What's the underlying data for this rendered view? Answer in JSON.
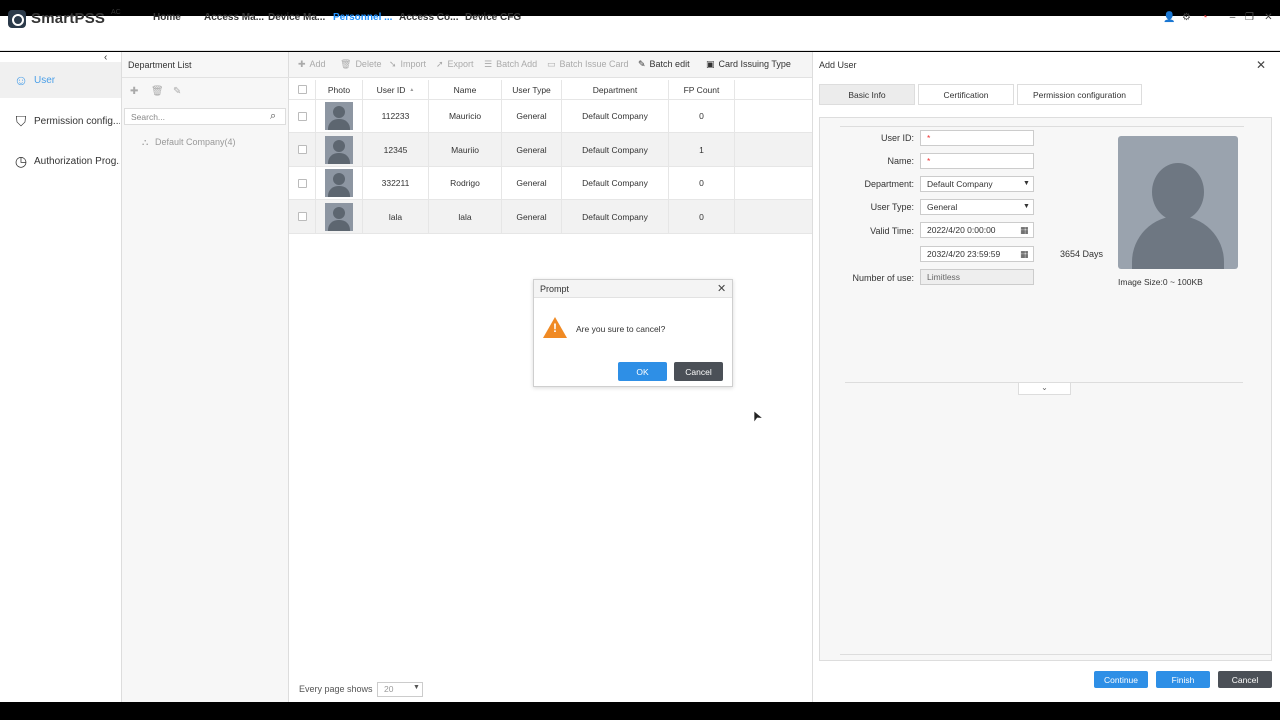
{
  "app": {
    "name": "SmartPSS",
    "name_sup": "AC"
  },
  "nav": [
    {
      "label": "Home"
    },
    {
      "label": "Access Ma..."
    },
    {
      "label": "Device Ma..."
    },
    {
      "label": "Personnel ..."
    },
    {
      "label": "Access Co..."
    },
    {
      "label": "Device CFG"
    }
  ],
  "sidebar": {
    "collapse": "‹",
    "items": [
      {
        "label": "User"
      },
      {
        "label": "Permission config..."
      },
      {
        "label": "Authorization Prog..."
      }
    ]
  },
  "department": {
    "title": "Department List",
    "search_placeholder": "Search...",
    "tree_root": "Default Company(4)"
  },
  "toolbar": {
    "add": "Add",
    "delete": "Delete",
    "import": "Import",
    "export": "Export",
    "batch_add": "Batch Add",
    "batch_issue_card": "Batch Issue Card",
    "batch_edit": "Batch edit",
    "card_issuing_type": "Card Issuing Type"
  },
  "table": {
    "columns": [
      "Photo",
      "User ID",
      "Name",
      "User Type",
      "Department",
      "FP Count"
    ],
    "sort_indicator": "▲",
    "rows": [
      {
        "user_id": "112233",
        "name": "Mauricio",
        "user_type": "General",
        "department": "Default Company",
        "fp_count": "0"
      },
      {
        "user_id": "12345",
        "name": "Mauriio",
        "user_type": "General",
        "department": "Default Company",
        "fp_count": "1"
      },
      {
        "user_id": "332211",
        "name": "Rodrigo",
        "user_type": "General",
        "department": "Default Company",
        "fp_count": "0"
      },
      {
        "user_id": "lala",
        "name": "lala",
        "user_type": "General",
        "department": "Default Company",
        "fp_count": "0"
      }
    ]
  },
  "pager": {
    "label": "Every page shows",
    "value": "20"
  },
  "add_user": {
    "title": "Add User",
    "tabs": [
      {
        "label": "Basic Info"
      },
      {
        "label": "Certification"
      },
      {
        "label": "Permission configuration"
      }
    ],
    "labels": {
      "user_id": "User ID:",
      "name": "Name:",
      "department": "Department:",
      "user_type": "User Type:",
      "valid_time": "Valid Time:",
      "number_of_use": "Number of use:"
    },
    "required_mark": "*",
    "department_value": "Default Company",
    "user_type_value": "General",
    "valid_start": "2022/4/20 0:00:00",
    "valid_end": "2032/4/20 23:59:59",
    "days": "3654 Days",
    "number_of_use_value": "Limitless",
    "image_size": "Image Size:0 ~ 100KB",
    "buttons": {
      "continue": "Continue",
      "finish": "Finish",
      "cancel": "Cancel"
    }
  },
  "prompt": {
    "title": "Prompt",
    "message": "Are you sure to cancel?",
    "warn_mark": "!",
    "ok": "OK",
    "cancel": "Cancel"
  },
  "colors": {
    "accent": "#2e8fe6",
    "dark_button": "#4b5057",
    "warning": "#f08a24",
    "active_nav": "#1e90ff"
  },
  "icons": [
    "logo-icon",
    "user-icon",
    "shield-icon",
    "clock-icon",
    "plus-icon",
    "trash-icon",
    "pencil-icon",
    "search-icon",
    "tree-icon",
    "calendar-icon",
    "warning-icon",
    "close-icon",
    "gear-icon",
    "person-icon"
  ]
}
